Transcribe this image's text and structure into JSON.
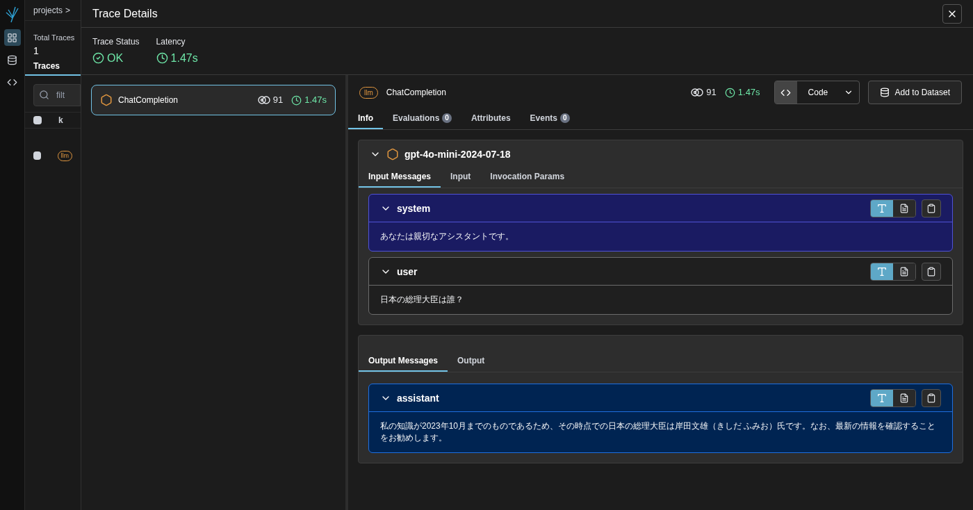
{
  "nav": {
    "items": [
      {
        "selected": true
      },
      {
        "selected": false
      },
      {
        "selected": false
      }
    ]
  },
  "background": {
    "breadcrumb": "projects",
    "breadcrumb_separator": ">",
    "stat_label": "Total Traces",
    "stat_value": "1",
    "tab": "Traces",
    "search_placeholder": "filt",
    "header_checked": false,
    "column_header": "k",
    "row_checked": false,
    "row_badge": "llm"
  },
  "drawer": {
    "title": "Trace Details",
    "stats": [
      {
        "label": "Trace Status",
        "value": "OK",
        "kind": "status"
      },
      {
        "label": "Latency",
        "value": "1.47s",
        "kind": "latency"
      }
    ],
    "tree": [
      {
        "name": "ChatCompletion",
        "tokens": "91",
        "latency": "1.47s",
        "selected": true
      }
    ],
    "span": {
      "badge": "llm",
      "name": "ChatCompletion",
      "tokens": "91",
      "latency": "1.47s",
      "code_button": "Code",
      "add_button": "Add to Dataset",
      "tabs": [
        {
          "label": "Info",
          "selected": true
        },
        {
          "label": "Evaluations",
          "count": "0",
          "selected": false
        },
        {
          "label": "Attributes",
          "selected": false
        },
        {
          "label": "Events",
          "count": "0",
          "selected": false
        }
      ],
      "model": "gpt-4o-mini-2024-07-18",
      "input_tabs": [
        {
          "label": "Input Messages",
          "selected": true
        },
        {
          "label": "Input",
          "selected": false
        },
        {
          "label": "Invocation Params",
          "selected": false
        }
      ],
      "input_messages": [
        {
          "role": "system",
          "color": "#1a1b62",
          "content": "あなたは親切なアシスタントです。",
          "text_view": true
        },
        {
          "role": "user",
          "color": "#1f1f1f",
          "content": "日本の総理大臣は誰？",
          "text_view": true
        }
      ],
      "output_tabs": [
        {
          "label": "Output Messages",
          "selected": true
        },
        {
          "label": "Output",
          "selected": false
        }
      ],
      "output_messages": [
        {
          "role": "assistant",
          "color": "#002452",
          "content": "私の知識が2023年10月までのものであるため、その時点での日本の総理大臣は岸田文雄（きしだ ふみお）氏です。なお、最新の情報を確認することをお勧めします。",
          "text_view": true
        }
      ]
    }
  }
}
